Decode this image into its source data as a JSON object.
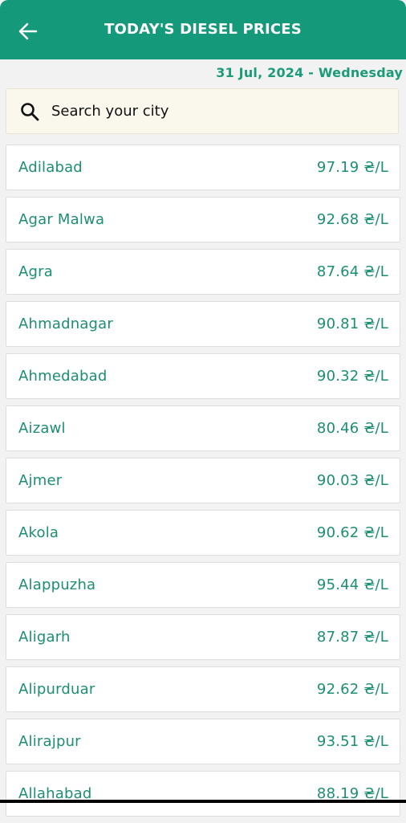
{
  "header": {
    "title": "TODAY'S DIESEL PRICES",
    "back_icon": "arrow-left-icon"
  },
  "date_line": "31 Jul, 2024 - Wednesday",
  "search": {
    "placeholder": "Search your city",
    "value": "",
    "icon": "search-icon"
  },
  "colors": {
    "header_bg": "#14997a",
    "accent_text": "#1c8e73",
    "search_bg": "#faf7ec",
    "page_bg": "#f2f2f2"
  },
  "cities": [
    {
      "name": "Adilabad",
      "price": "97.19 ₴/L"
    },
    {
      "name": "Agar Malwa",
      "price": "92.68 ₴/L"
    },
    {
      "name": "Agra",
      "price": "87.64 ₴/L"
    },
    {
      "name": "Ahmadnagar",
      "price": "90.81 ₴/L"
    },
    {
      "name": "Ahmedabad",
      "price": "90.32 ₴/L"
    },
    {
      "name": "Aizawl",
      "price": "80.46 ₴/L"
    },
    {
      "name": "Ajmer",
      "price": "90.03 ₴/L"
    },
    {
      "name": "Akola",
      "price": "90.62 ₴/L"
    },
    {
      "name": "Alappuzha",
      "price": "95.44 ₴/L"
    },
    {
      "name": "Aligarh",
      "price": "87.87 ₴/L"
    },
    {
      "name": "Alipurduar",
      "price": "92.62 ₴/L"
    },
    {
      "name": "Alirajpur",
      "price": "93.51 ₴/L"
    },
    {
      "name": "Allahabad",
      "price": "88.19 ₴/L"
    }
  ]
}
